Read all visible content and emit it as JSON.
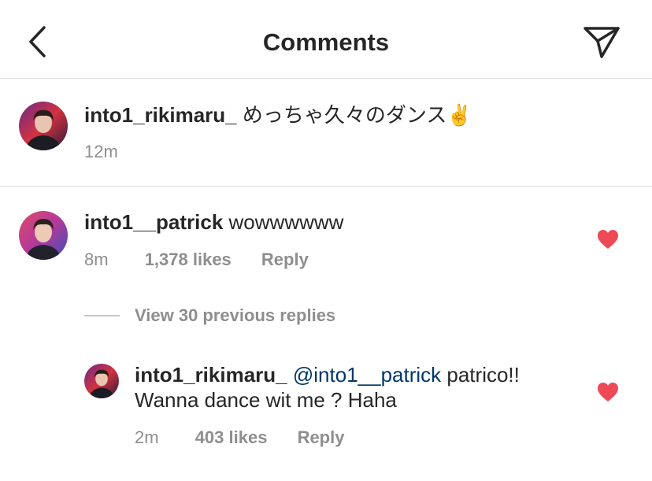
{
  "header": {
    "title": "Comments",
    "back_icon": "chevron-left-icon",
    "share_icon": "paper-plane-icon"
  },
  "caption": {
    "username": "into1_rikimaru_",
    "text": "めっちゃ久々のダンス",
    "emoji": "✌️",
    "time": "12m"
  },
  "comment": {
    "username": "into1__patrick",
    "text": "wowwwwww",
    "time": "8m",
    "likes": "1,378 likes",
    "reply_label": "Reply",
    "liked": true
  },
  "view_replies": "View 30 previous replies",
  "reply": {
    "username": "into1_rikimaru_",
    "mention": "@into1__patrick",
    "text_line1": "patrico!!",
    "text_line2": "Wanna dance wit me ? Haha",
    "time": "2m",
    "likes": "403 likes",
    "reply_label": "Reply",
    "liked": true
  },
  "colors": {
    "like": "#ed4956",
    "mention": "#00376b",
    "secondary": "#8e8e8e",
    "divider": "#dbdbdb"
  }
}
